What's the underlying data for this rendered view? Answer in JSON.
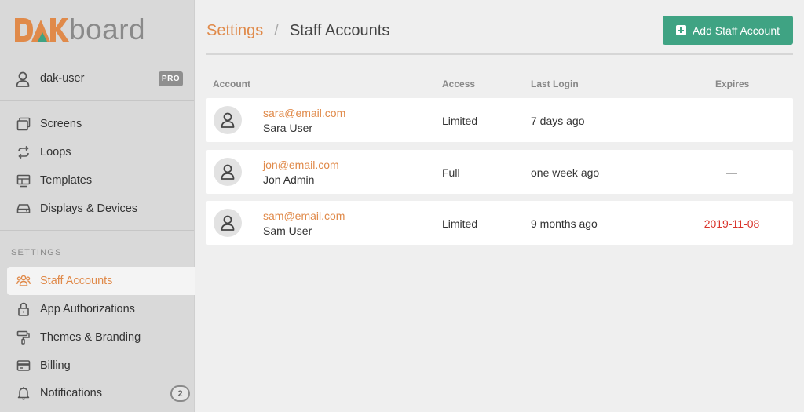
{
  "brand": {
    "logo_text": "board",
    "accent": "#e08a4a",
    "green": "#3fa383"
  },
  "user": {
    "name": "dak-user",
    "plan_badge": "PRO"
  },
  "nav": {
    "main": [
      {
        "label": "Screens",
        "icon": "screens-icon"
      },
      {
        "label": "Loops",
        "icon": "loop-icon"
      },
      {
        "label": "Templates",
        "icon": "templates-icon"
      },
      {
        "label": "Displays & Devices",
        "icon": "device-icon"
      }
    ],
    "settings_title": "SETTINGS",
    "settings": [
      {
        "label": "Staff Accounts",
        "icon": "staff-icon",
        "active": true
      },
      {
        "label": "App Authorizations",
        "icon": "lock-icon"
      },
      {
        "label": "Themes & Branding",
        "icon": "paint-roller-icon"
      },
      {
        "label": "Billing",
        "icon": "credit-card-icon"
      },
      {
        "label": "Notifications",
        "icon": "bell-icon",
        "count": "2"
      }
    ]
  },
  "header": {
    "breadcrumb_parent": "Settings",
    "breadcrumb_sep": "/",
    "breadcrumb_current": "Staff Accounts",
    "add_button": "Add Staff Account"
  },
  "table": {
    "columns": {
      "account": "Account",
      "access": "Access",
      "last_login": "Last Login",
      "expires": "Expires"
    },
    "rows": [
      {
        "email": "sara@email.com",
        "name": "Sara User",
        "access": "Limited",
        "last_login": "7 days ago",
        "expires": "—"
      },
      {
        "email": "jon@email.com",
        "name": "Jon Admin",
        "access": "Full",
        "last_login": "one week ago",
        "expires": "—"
      },
      {
        "email": "sam@email.com",
        "name": "Sam User",
        "access": "Limited",
        "last_login": "9 months ago",
        "expires": "2019-11-08"
      }
    ]
  }
}
